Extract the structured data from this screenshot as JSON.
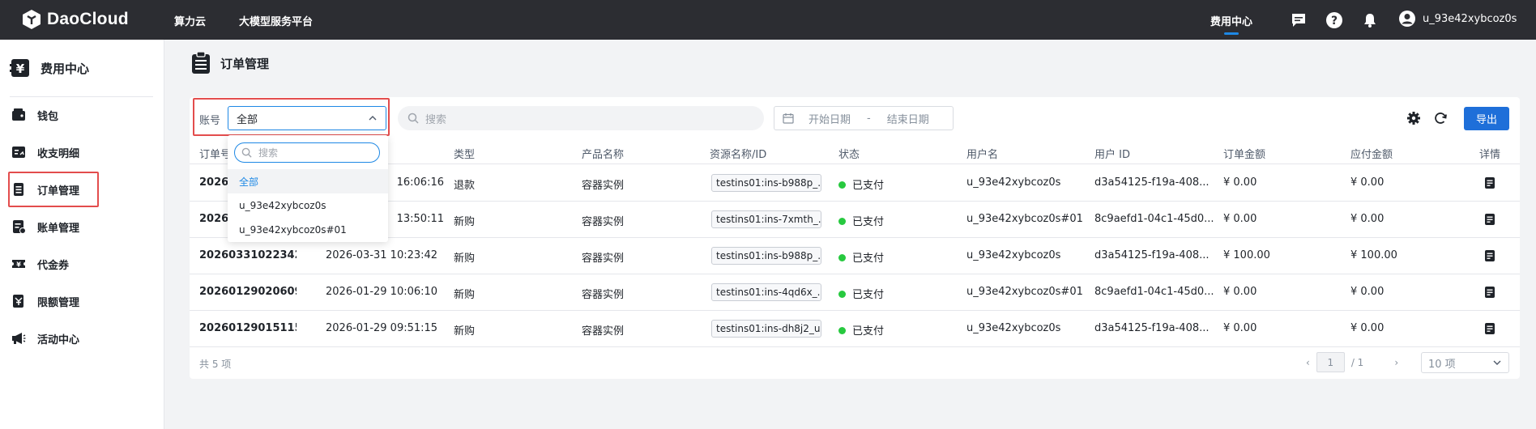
{
  "topbar": {
    "logo_text": "DaoCloud",
    "nav": [
      "算力云",
      "大模型服务平台"
    ],
    "active_tab": "费用中心",
    "username": "u_93e42xybcoz0s"
  },
  "sidebar": {
    "title": "费用中心",
    "items": [
      {
        "label": "钱包",
        "icon": "wallet-icon"
      },
      {
        "label": "收支明细",
        "icon": "ledger-icon"
      },
      {
        "label": "订单管理",
        "icon": "order-icon"
      },
      {
        "label": "账单管理",
        "icon": "bill-icon"
      },
      {
        "label": "代金券",
        "icon": "voucher-icon"
      },
      {
        "label": "限额管理",
        "icon": "limit-icon"
      },
      {
        "label": "活动中心",
        "icon": "megaphone-icon"
      }
    ],
    "active": "订单管理"
  },
  "page": {
    "title": "订单管理"
  },
  "filters": {
    "account_label": "账号",
    "account_value": "全部",
    "search_placeholder": "搜索",
    "start_date_placeholder": "开始日期",
    "date_separator": "-",
    "end_date_placeholder": "结束日期",
    "export_label": "导出"
  },
  "dropdown": {
    "search_placeholder": "搜索",
    "options": [
      "全部",
      "u_93e42xybcoz0s",
      "u_93e42xybcoz0s#01"
    ],
    "selected": "全部"
  },
  "table": {
    "columns": [
      "订单号",
      "创建时间",
      "类型",
      "产品名称",
      "资源名称/ID",
      "状态",
      "用户名",
      "用户 ID",
      "订单金额",
      "应付金额",
      "详情"
    ],
    "visible_header_fragment": "订单号",
    "rows": [
      {
        "order": "20260",
        "time": "16:06:16",
        "type": "退款",
        "product": "容器实例",
        "resource": "testins01:ins-b988p_...",
        "status": "已支付",
        "user": "u_93e42xybcoz0s",
        "uid": "d3a54125-f19a-408...",
        "amount": "¥ 0.00",
        "payable": "¥ 0.00"
      },
      {
        "order": "20260",
        "time": "13:50:11",
        "type": "新购",
        "product": "容器实例",
        "resource": "testins01:ins-7xmth_...",
        "status": "已支付",
        "user": "u_93e42xybcoz0s#01",
        "uid": "8c9aefd1-04c1-45d0...",
        "amount": "¥ 0.00",
        "payable": "¥ 0.00"
      },
      {
        "order": "2026033102234200...",
        "time": "2026-03-31 10:23:42",
        "type": "新购",
        "product": "容器实例",
        "resource": "testins01:ins-b988p_...",
        "status": "已支付",
        "user": "u_93e42xybcoz0s",
        "uid": "d3a54125-f19a-408...",
        "amount": "¥ 100.00",
        "payable": "¥ 100.00"
      },
      {
        "order": "2026012902060982...",
        "time": "2026-01-29 10:06:10",
        "type": "新购",
        "product": "容器实例",
        "resource": "testins01:ins-4qd6x_...",
        "status": "已支付",
        "user": "u_93e42xybcoz0s#01",
        "uid": "8c9aefd1-04c1-45d0...",
        "amount": "¥ 0.00",
        "payable": "¥ 0.00"
      },
      {
        "order": "2026012901511514...",
        "time": "2026-01-29 09:51:15",
        "type": "新购",
        "product": "容器实例",
        "resource": "testins01:ins-dh8j2_u...",
        "status": "已支付",
        "user": "u_93e42xybcoz0s",
        "uid": "d3a54125-f19a-408...",
        "amount": "¥ 0.00",
        "payable": "¥ 0.00"
      }
    ]
  },
  "footer": {
    "total": "共 5 项",
    "page_current": "1",
    "page_total": "/ 1",
    "page_size": "10 项"
  },
  "colors": {
    "topbar": "#2c2d32",
    "accent": "#1e88e5",
    "export_button": "#1e6fd9",
    "status_paid": "#27c93f",
    "highlight": "#e34d4d"
  }
}
